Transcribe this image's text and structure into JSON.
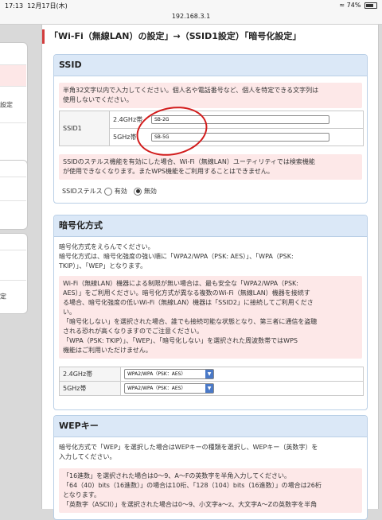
{
  "status_bar": {
    "time": "17:13",
    "date": "12月17日(木)",
    "battery": "74%",
    "battery_level": 0.74
  },
  "browser": {
    "url": "192.168.3.1"
  },
  "sidebar": {
    "items": [
      {
        "label": ""
      },
      {
        "label": ""
      },
      {
        "label": "設定"
      },
      {
        "label": ""
      },
      {
        "label": ""
      },
      {
        "label": ""
      },
      {
        "label": ""
      },
      {
        "label": "定"
      }
    ]
  },
  "page": {
    "title": "「Wi-Fi（無線LAN）の設定」→（SSID1設定）「暗号化設定」"
  },
  "ssid": {
    "header": "SSID",
    "note": "半角32文字以内で入力してください。個人名や電話番号など、個人を特定できる文字列は\n使用しないでください。",
    "row_label": "SSID1",
    "band_24": "2.4GHz帯",
    "band_5": "5GHz帯",
    "value_24": "SB-2G",
    "value_5": "SB-5G",
    "stealth_note": "SSIDのステルス機能を有効にした場合、Wi-Fi（無線LAN）ユーティリティでは検索機能\nが使用できなくなります。またWPS機能をご利用することはできません。",
    "stealth_label": "SSIDステルス",
    "stealth_on": "有効",
    "stealth_off": "無効"
  },
  "encryption": {
    "header": "暗号化方式",
    "intro": "暗号化方式をえらんでください。\n暗号化方式は、暗号化強度の強い順に「WPA2/WPA（PSK: AES）」、「WPA（PSK:\nTKIP）」、「WEP」となります。",
    "warning": "Wi-Fi（無線LAN）機器による制限が無い場合は、最も安全な「WPA2/WPA（PSK:\nAES）」をご利用ください。暗号化方式が異なる複数のWi-Fi（無線LAN）機器を接続す\nる場合、暗号化強度の低いWi-Fi（無線LAN）機器は「SSID2」に接続してご利用くださ\nい。\n「暗号化しない」を選択された場合、誰でも接続可能な状態となり、第三者に通信を盗聴\nされる恐れが高くなりますのでご注意ください。\n「WPA（PSK: TKIP）」、「WEP」、「暗号化しない」を選択された周波数帯ではWPS\n機能はご利用いただけません。",
    "band_24": "2.4GHz帯",
    "band_5": "5GHz帯",
    "value_24": "WPA2/WPA（PSK：AES）",
    "value_5": "WPA2/WPA（PSK：AES）"
  },
  "wep": {
    "header": "WEPキー",
    "intro": "暗号化方式で「WEP」を選択した場合はWEPキーの種類を選択し、WEPキー（英数字）を\n入力してください。",
    "note": "「16進数」を選択された場合は0～9、A～Fの英数字を半角入力してください。\n「64（40）bits（16進数）」の場合は10桁、「128（104）bits（16進数）」の場合は26桁\nとなります。\n「英数字（ASCII）」を選択された場合は0～9、小文字a～z、大文字A～Zの英数字を半角"
  },
  "colors": {
    "accent_red": "#d23d3d",
    "section_header": "#dbe8f7",
    "note_bg": "#fde8e8",
    "select_arrow": "#4a79c7"
  }
}
